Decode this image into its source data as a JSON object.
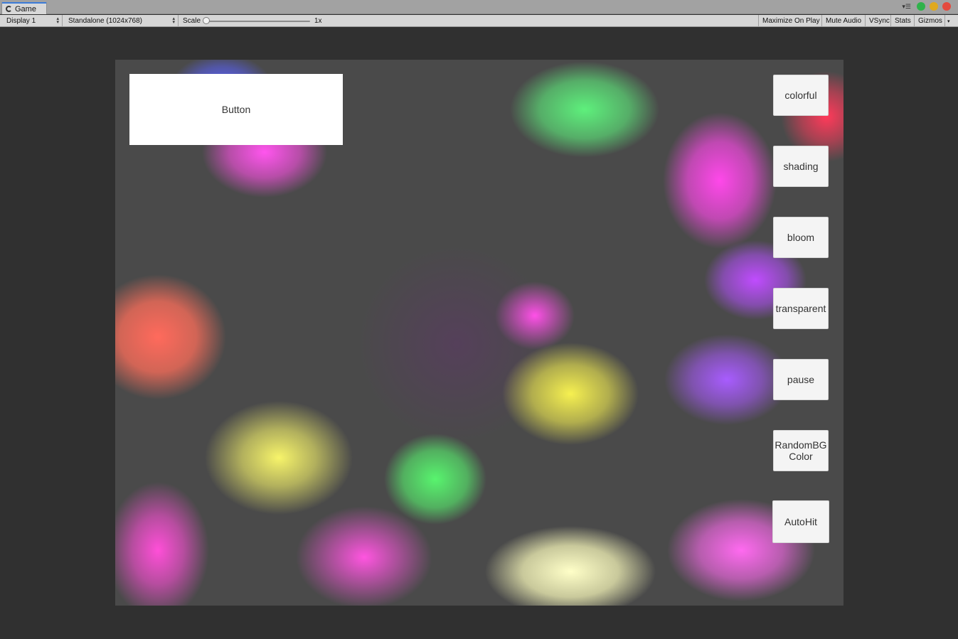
{
  "tab": {
    "title": "Game"
  },
  "window_controls": {
    "colors": [
      "#2fb24b",
      "#e0a91e",
      "#e44a3e"
    ]
  },
  "toolbar": {
    "display": "Display 1",
    "resolution": "Standalone (1024x768)",
    "scale_label": "Scale",
    "scale_value": "1x",
    "maximize_on_play": "Maximize On Play",
    "mute_audio": "Mute Audio",
    "vsync": "VSync",
    "stats": "Stats",
    "gizmos": "Gizmos"
  },
  "game": {
    "top_button": "Button",
    "side_buttons": [
      "colorful",
      "shading",
      "bloom",
      "transparent",
      "pause",
      "RandomBG\nColor",
      "AutoHit"
    ]
  }
}
